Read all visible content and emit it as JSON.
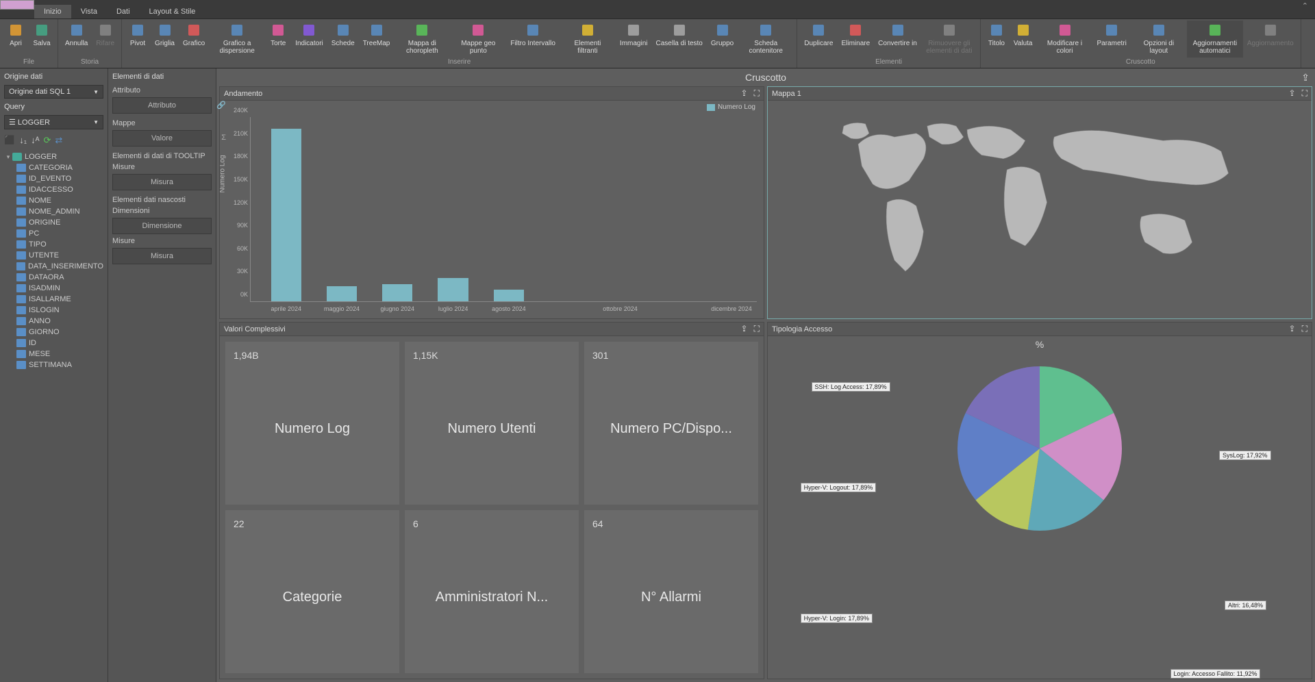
{
  "tabs": [
    "Inizio",
    "Vista",
    "Dati",
    "Layout & Stile"
  ],
  "active_tab": 0,
  "ribbon": {
    "groups": [
      {
        "label": "File",
        "items": [
          {
            "name": "apri",
            "label": "Apri",
            "color": "#e8a030"
          },
          {
            "name": "salva",
            "label": "Salva",
            "color": "#4a8"
          }
        ]
      },
      {
        "label": "Storia",
        "items": [
          {
            "name": "annulla",
            "label": "Annulla",
            "color": "#5a8fc7"
          },
          {
            "name": "rifare",
            "label": "Rifare",
            "color": "#888",
            "disabled": true
          }
        ]
      },
      {
        "label": "Inserire",
        "items": [
          {
            "name": "pivot",
            "label": "Pivot",
            "color": "#5a8fc7"
          },
          {
            "name": "griglia",
            "label": "Griglia",
            "color": "#5a8fc7"
          },
          {
            "name": "grafico",
            "label": "Grafico",
            "color": "#e85a5a"
          },
          {
            "name": "grafico-dispersione",
            "label": "Grafico a dispersione",
            "color": "#5a8fc7"
          },
          {
            "name": "torte",
            "label": "Torte",
            "color": "#e85aa0"
          },
          {
            "name": "indicatori",
            "label": "Indicatori",
            "color": "#8a5ae8"
          },
          {
            "name": "schede",
            "label": "Schede",
            "color": "#5a8fc7"
          },
          {
            "name": "treemap",
            "label": "TreeMap",
            "color": "#5a8fc7"
          },
          {
            "name": "mappa-choropleth",
            "label": "Mappa di choropleth",
            "color": "#5ac75a"
          },
          {
            "name": "mappe-geo-punto",
            "label": "Mappe geo punto",
            "color": "#e85aa0"
          },
          {
            "name": "filtro-intervallo",
            "label": "Filtro Intervallo",
            "color": "#5a8fc7"
          },
          {
            "name": "elementi-filtranti",
            "label": "Elementi filtranti",
            "color": "#e8c030"
          },
          {
            "name": "immagini",
            "label": "Immagini",
            "color": "#aaa"
          },
          {
            "name": "casella-testo",
            "label": "Casella di testo",
            "color": "#aaa"
          },
          {
            "name": "gruppo",
            "label": "Gruppo",
            "color": "#5a8fc7"
          },
          {
            "name": "scheda-contenitore",
            "label": "Scheda contenitore",
            "color": "#5a8fc7"
          }
        ]
      },
      {
        "label": "Elementi",
        "items": [
          {
            "name": "duplicare",
            "label": "Duplicare",
            "color": "#5a8fc7"
          },
          {
            "name": "eliminare",
            "label": "Eliminare",
            "color": "#e85a5a"
          },
          {
            "name": "convertire-in",
            "label": "Convertire in",
            "color": "#5a8fc7"
          },
          {
            "name": "rimuovere-elementi",
            "label": "Rimuovere gli elementi di dati",
            "color": "#888",
            "disabled": true
          }
        ]
      },
      {
        "label": "Cruscotto",
        "items": [
          {
            "name": "titolo",
            "label": "Titolo",
            "color": "#5a8fc7"
          },
          {
            "name": "valuta",
            "label": "Valuta",
            "color": "#e8c030"
          },
          {
            "name": "modificare-colori",
            "label": "Modificare i colori",
            "color": "#e85aa0"
          },
          {
            "name": "parametri",
            "label": "Parametri",
            "color": "#5a8fc7"
          },
          {
            "name": "opzioni-layout",
            "label": "Opzioni di layout",
            "color": "#5a8fc7"
          },
          {
            "name": "aggiornamenti-automatici",
            "label": "Aggiornamenti automatici",
            "color": "#5ac75a",
            "active": true
          },
          {
            "name": "aggiornamento",
            "label": "Aggiornamento",
            "color": "#888",
            "disabled": true
          }
        ]
      }
    ]
  },
  "left_panel": {
    "origine_label": "Origine dati",
    "origine_value": "Origine dati SQL 1",
    "query_label": "Query",
    "query_value": "LOGGER",
    "tree_root": "LOGGER",
    "columns": [
      "CATEGORIA",
      "ID_EVENTO",
      "IDACCESSO",
      "NOME",
      "NOME_ADMIN",
      "ORIGINE",
      "PC",
      "TIPO",
      "UTENTE",
      "DATA_INSERIMENTO",
      "DATAORA",
      "ISADMIN",
      "ISALLARME",
      "ISLOGIN",
      "ANNO",
      "GIORNO",
      "ID",
      "MESE",
      "SETTIMANA"
    ]
  },
  "mid_panel": {
    "title": "Elementi di dati",
    "sections": [
      {
        "label": "Attributo",
        "target": "Attributo",
        "icon": "link"
      },
      {
        "label": "Mappe",
        "target": "Valore",
        "icon": "sigma"
      },
      {
        "label": "Elementi di dati di TOOLTIP",
        "sub": "Misure",
        "target": "Misura"
      },
      {
        "label": "Elementi dati nascosti",
        "sub": "Dimensioni",
        "target": "Dimensione"
      },
      {
        "label": "",
        "sub": "Misure",
        "target": "Misura"
      }
    ]
  },
  "dashboard_title": "Cruscotto",
  "widgets": {
    "andamento": {
      "title": "Andamento"
    },
    "mappa": {
      "title": "Mappa 1"
    },
    "valori": {
      "title": "Valori Complessivi"
    },
    "tipologia": {
      "title": "Tipologia Accesso"
    }
  },
  "cards": [
    {
      "value": "1,94B",
      "label": "Numero Log"
    },
    {
      "value": "1,15K",
      "label": "Numero Utenti"
    },
    {
      "value": "301",
      "label": "Numero PC/Dispo..."
    },
    {
      "value": "22",
      "label": "Categorie"
    },
    {
      "value": "6",
      "label": "Amministratori N..."
    },
    {
      "value": "64",
      "label": "N° Allarmi"
    }
  ],
  "chart_data": {
    "bar": {
      "type": "bar",
      "title": "Andamento",
      "ylabel": "Numero Log",
      "legend": "Numero Log",
      "ylim": [
        0,
        240000
      ],
      "yticks": [
        "0K",
        "30K",
        "60K",
        "90K",
        "120K",
        "150K",
        "180K",
        "210K",
        "240K"
      ],
      "categories": [
        "aprile 2024",
        "maggio 2024",
        "giugno 2024",
        "luglio 2024",
        "agosto 2024",
        "ottobre 2024",
        "dicembre 2024"
      ],
      "values": [
        225000,
        20000,
        22000,
        30000,
        15000,
        0,
        0
      ]
    },
    "pie": {
      "type": "pie",
      "title": "%",
      "slices": [
        {
          "name": "SSH: Log Access",
          "value": 17.89,
          "color": "#5fbf8f"
        },
        {
          "name": "SysLog",
          "value": 17.92,
          "color": "#d08fc7"
        },
        {
          "name": "Altri",
          "value": 16.48,
          "color": "#5fa8b8"
        },
        {
          "name": "Login: Accesso Fallito",
          "value": 11.92,
          "color": "#b8c75f"
        },
        {
          "name": "Hyper-V: Login",
          "value": 17.89,
          "color": "#5f7fc7"
        },
        {
          "name": "Hyper-V: Logout",
          "value": 17.89,
          "color": "#7a6fb8"
        }
      ],
      "labels": [
        {
          "text": "SSH: Log Access: 17,89%",
          "x": 8,
          "y": 9
        },
        {
          "text": "SysLog: 17,92%",
          "x": 83,
          "y": 30
        },
        {
          "text": "Altri: 16,48%",
          "x": 84,
          "y": 76
        },
        {
          "text": "Login: Accesso Fallito: 11,92%",
          "x": 74,
          "y": 97
        },
        {
          "text": "Hyper-V: Login: 17,89%",
          "x": 6,
          "y": 80
        },
        {
          "text": "Hyper-V: Logout: 17,89%",
          "x": 6,
          "y": 40
        }
      ]
    }
  }
}
